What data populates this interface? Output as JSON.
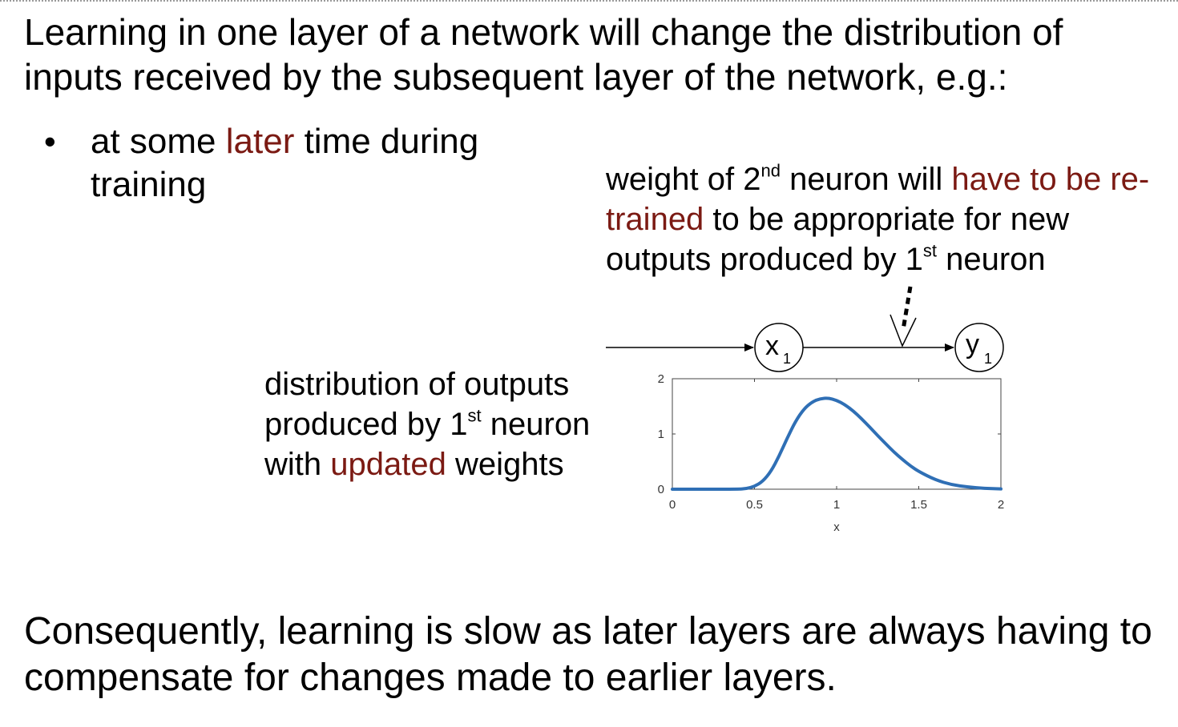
{
  "intro": "Learning in one layer of a network will change the distribution of inputs received by the subsequent layer of the network, e.g.:",
  "bullet": {
    "part1": "at some ",
    "highlight": "later",
    "part2": " time during training"
  },
  "weight_note": {
    "part1": "weight of 2",
    "sup1": "nd",
    "part2": " neuron will ",
    "highlight": "have to be re-trained",
    "part3": " to be appropriate for new outputs produced by 1",
    "sup2": "st",
    "part4": " neuron"
  },
  "distribution_note": {
    "part1": "distribution of outputs produced by 1",
    "sup": "st",
    "part2": " neuron with ",
    "highlight": "updated",
    "part3": " weights"
  },
  "network": {
    "node1": {
      "label": "x",
      "sub": "1"
    },
    "node2": {
      "label": "y",
      "sub": "1"
    }
  },
  "chart_data": {
    "type": "line",
    "xlabel": "x",
    "ylabel": "",
    "xlim": [
      0,
      2
    ],
    "ylim": [
      0,
      2
    ],
    "xticks": [
      "0",
      "0.5",
      "1",
      "1.5",
      "2"
    ],
    "yticks": [
      "0",
      "1",
      "2"
    ],
    "series": [
      {
        "color": "#2f6fb5",
        "x": [
          0,
          0.2,
          0.4,
          0.45,
          0.5,
          0.55,
          0.6,
          0.65,
          0.7,
          0.75,
          0.8,
          0.85,
          0.9,
          0.95,
          1.0,
          1.05,
          1.1,
          1.15,
          1.2,
          1.25,
          1.3,
          1.35,
          1.4,
          1.45,
          1.5,
          1.6,
          1.7,
          1.8,
          1.9,
          2.0
        ],
        "y": [
          0,
          0,
          0,
          0.01,
          0.05,
          0.14,
          0.32,
          0.6,
          0.93,
          1.23,
          1.45,
          1.58,
          1.64,
          1.65,
          1.61,
          1.53,
          1.42,
          1.28,
          1.13,
          0.97,
          0.82,
          0.67,
          0.54,
          0.42,
          0.32,
          0.17,
          0.08,
          0.04,
          0.015,
          0.005
        ]
      }
    ],
    "grid": false,
    "legend": "none"
  },
  "conclusion": "Consequently, learning is slow as later layers are always having to compensate for changes made to earlier layers."
}
